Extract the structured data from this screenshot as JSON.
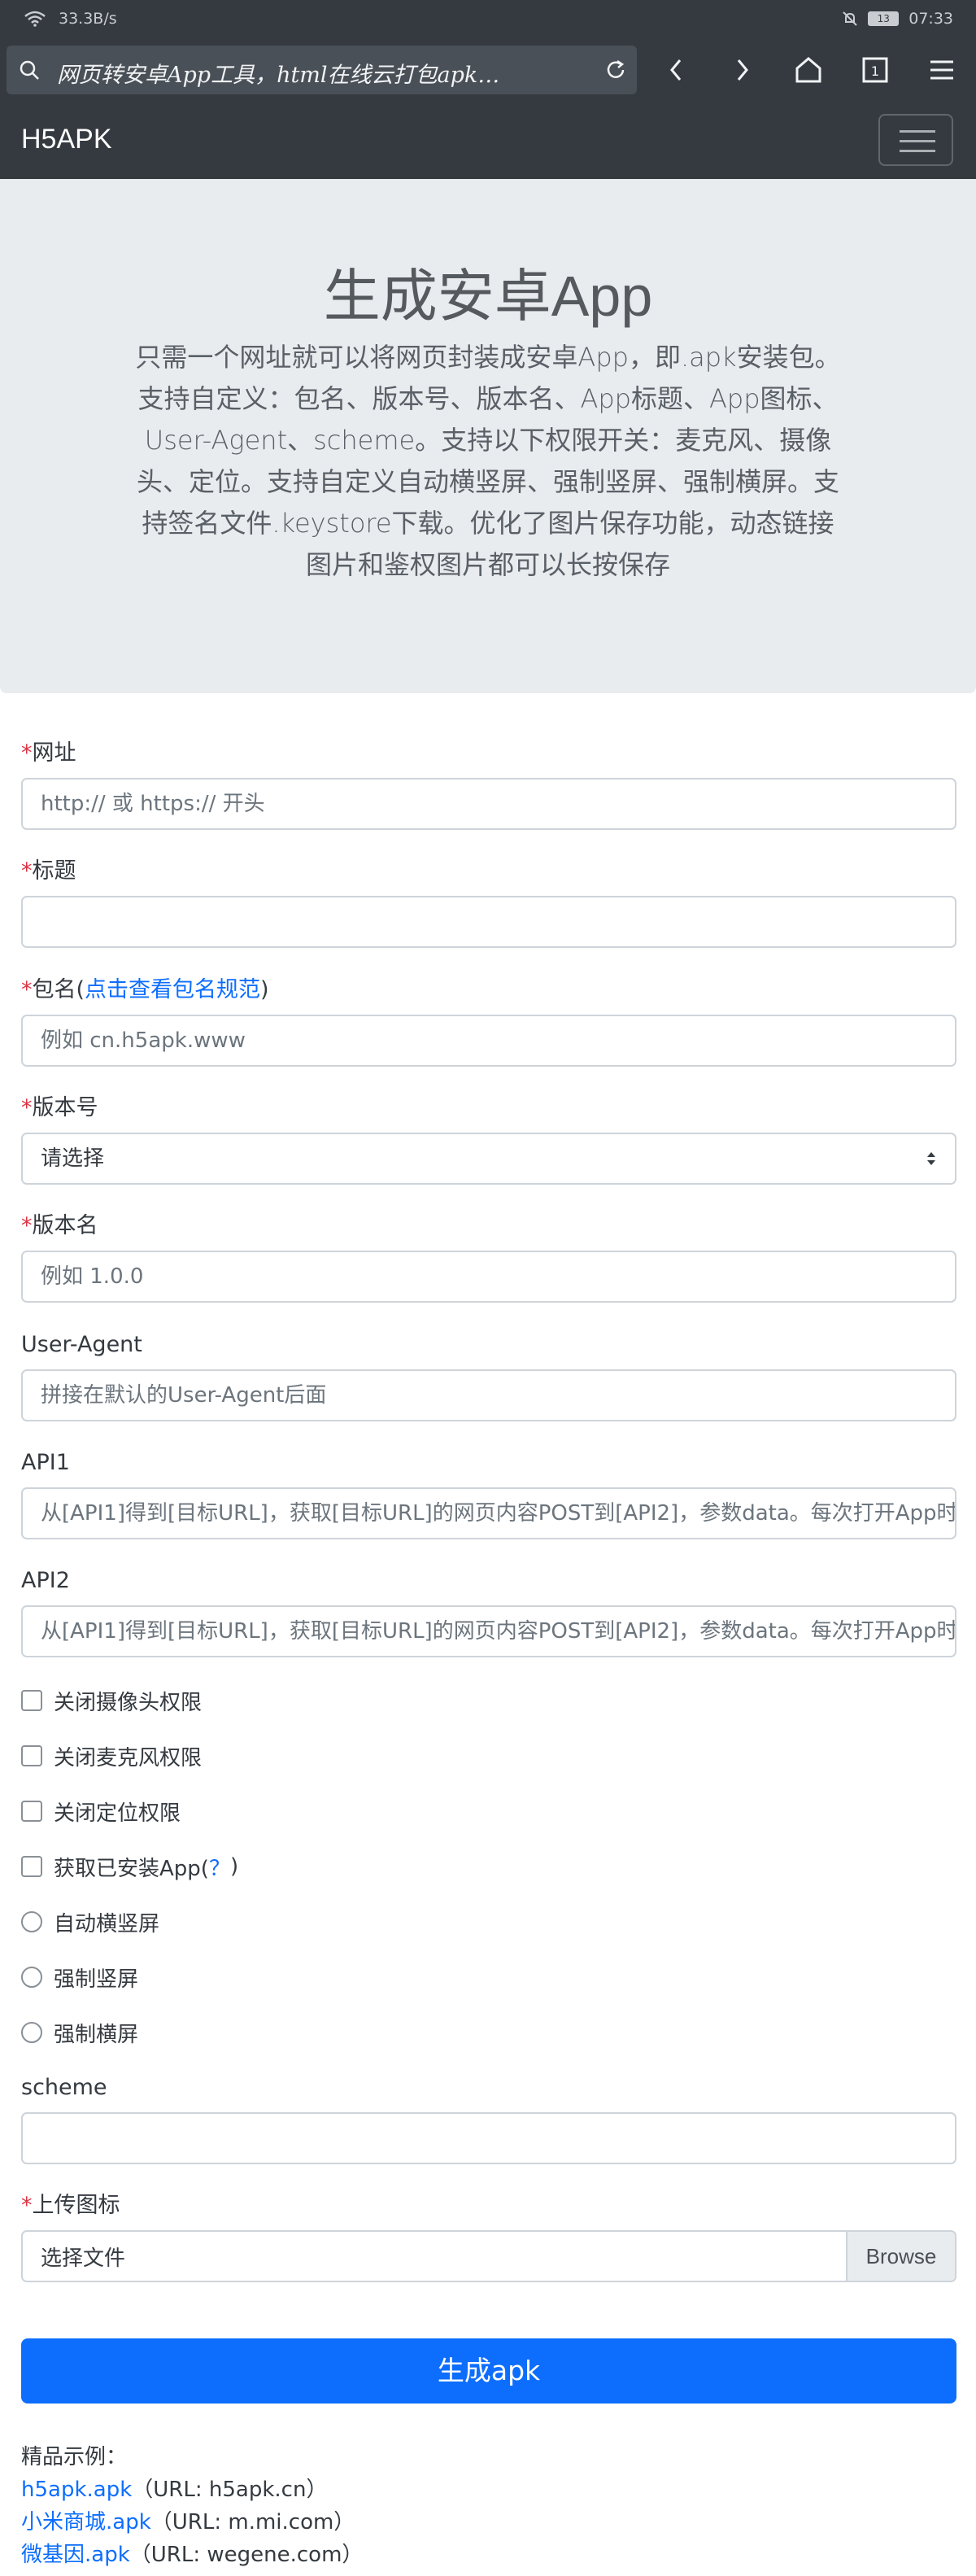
{
  "status": {
    "speed": "33.3B/s",
    "time": "07:33",
    "battery": "13"
  },
  "browser": {
    "url_text": "网页转安卓App工具，html在线云打包apk…"
  },
  "navbar": {
    "brand": "H5APK"
  },
  "hero": {
    "title": "生成安卓App",
    "description": "只需一个网址就可以将网页封装成安卓App，即.apk安装包。支持自定义：包名、版本号、版本名、App标题、App图标、User-Agent、scheme。支持以下权限开关：麦克风、摄像头、定位。支持自定义自动横竖屏、强制竖屏、强制横屏。支持签名文件.keystore下载。优化了图片保存功能，动态链接图片和鉴权图片都可以长按保存"
  },
  "form": {
    "required_mark": "*",
    "url": {
      "label": "网址",
      "placeholder": "http:// 或 https:// 开头"
    },
    "title": {
      "label": "标题",
      "value": ""
    },
    "package": {
      "label": "包名(",
      "link": "点击查看包名规范",
      "label_end": ")",
      "placeholder": "例如 cn.h5apk.www"
    },
    "version_code": {
      "label": "版本号",
      "selected": "请选择"
    },
    "version_name": {
      "label": "版本名",
      "placeholder": "例如 1.0.0"
    },
    "user_agent": {
      "label": "User-Agent",
      "placeholder": "拼接在默认的User-Agent后面"
    },
    "api1": {
      "label": "API1",
      "placeholder": "从[API1]得到[目标URL]，获取[目标URL]的网页内容POST到[API2]，参数data。每次打开App时"
    },
    "api2": {
      "label": "API2",
      "placeholder": "从[API1]得到[目标URL]，获取[目标URL]的网页内容POST到[API2]，参数data。每次打开App时"
    },
    "checkboxes": [
      {
        "label": "关闭摄像头权限"
      },
      {
        "label": "关闭麦克风权限"
      },
      {
        "label": "关闭定位权限"
      },
      {
        "label": "获取已安装App(",
        "link": "？",
        "label_end": ")"
      }
    ],
    "radios": [
      {
        "label": "自动横竖屏"
      },
      {
        "label": "强制竖屏"
      },
      {
        "label": "强制横屏"
      }
    ],
    "scheme": {
      "label": "scheme",
      "value": ""
    },
    "icon": {
      "label": "上传图标",
      "file_label": "选择文件",
      "browse": "Browse"
    },
    "submit": "生成apk"
  },
  "examples": {
    "heading": "精品示例：",
    "items": [
      {
        "name": "h5apk.apk",
        "url": "（URL: h5apk.cn）"
      },
      {
        "name": "小米商城.apk",
        "url": "（URL: m.mi.com）"
      },
      {
        "name": "微基因.apk",
        "url": "（URL: wegene.com）"
      }
    ]
  }
}
